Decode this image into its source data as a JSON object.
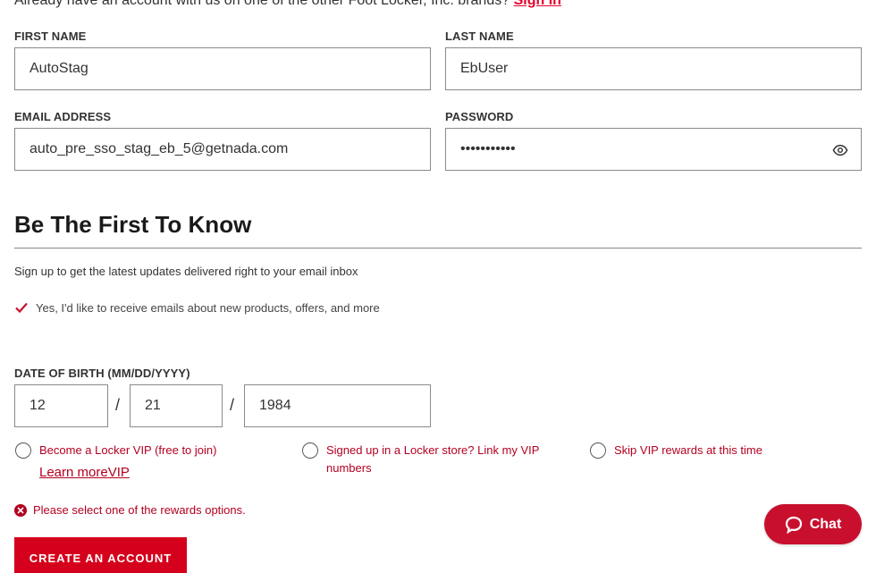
{
  "signin_prompt": {
    "text": "Already have an account with us on one of the other Foot Locker, Inc. brands?",
    "link": "Sign In"
  },
  "fields": {
    "first_name": {
      "label": "FIRST NAME",
      "value": "AutoStag"
    },
    "last_name": {
      "label": "LAST NAME",
      "value": "EbUser"
    },
    "email": {
      "label": "EMAIL ADDRESS",
      "value": "auto_pre_sso_stag_eb_5@getnada.com"
    },
    "password": {
      "label": "PASSWORD",
      "value": "•••••••••••",
      "toggle_icon": "eye-icon"
    }
  },
  "newsletter": {
    "heading": "Be The First To Know",
    "subtext": "Sign up to get the latest updates delivered right to your email inbox",
    "checkbox_label": "Yes, I'd like to receive emails about new products, offers, and more",
    "checked": true
  },
  "dob": {
    "label": "DATE OF BIRTH (MM/DD/YYYY)",
    "month": "12",
    "day": "21",
    "year": "1984",
    "separator": "/"
  },
  "vip": {
    "option_join": "Become a Locker VIP (free to join)",
    "learn_more": "Learn moreVIP",
    "option_link": "Signed up in a Locker store? Link my VIP numbers",
    "option_skip": "Skip VIP rewards at this time"
  },
  "error": {
    "message": "Please select one of the rewards options."
  },
  "create_button": "CREATE AN ACCOUNT",
  "chat_button": "Chat",
  "colors": {
    "accent": "#d5001c",
    "error": "#b30020"
  }
}
